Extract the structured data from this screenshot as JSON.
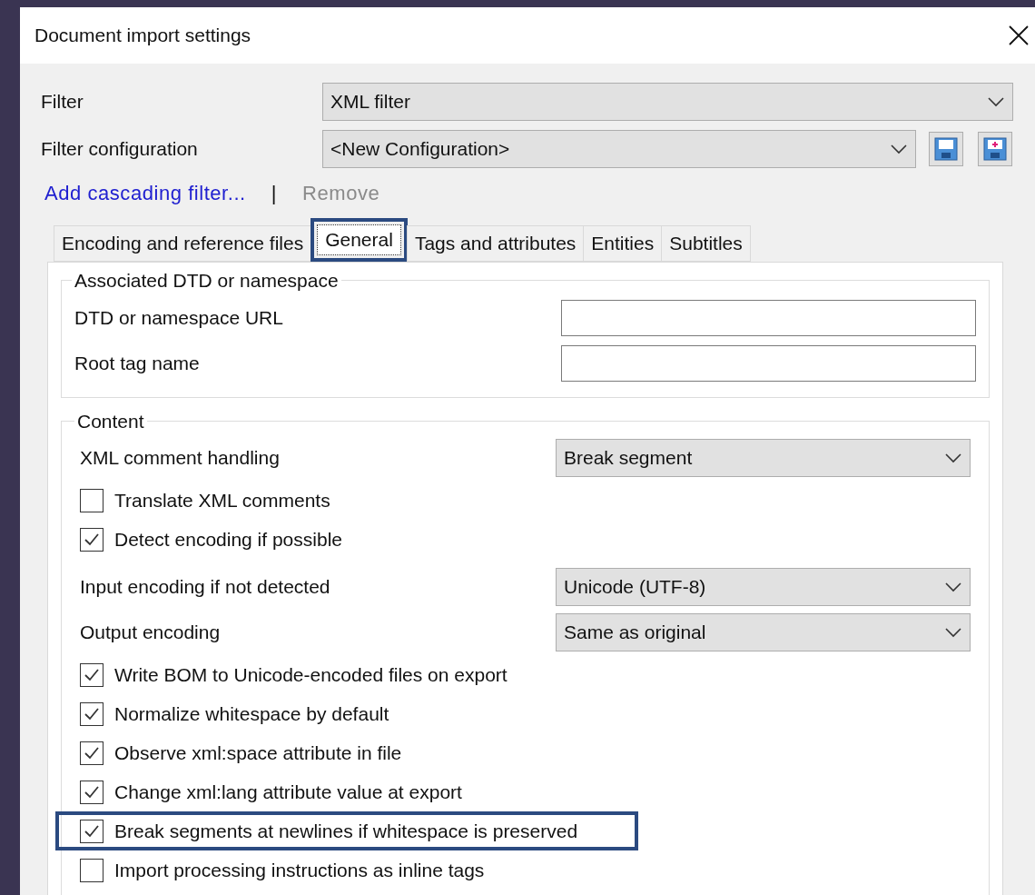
{
  "window": {
    "title": "Document import settings"
  },
  "filter": {
    "label": "Filter",
    "value": "XML filter"
  },
  "filter_configuration": {
    "label": "Filter configuration",
    "value": "<New Configuration>"
  },
  "links": {
    "add": "Add cascading filter...",
    "separator": "|",
    "remove": "Remove",
    "remove_disabled": true
  },
  "tabs": [
    {
      "label": "Encoding and reference files",
      "selected": false,
      "highlighted": false
    },
    {
      "label": "General",
      "selected": true,
      "highlighted": true
    },
    {
      "label": "Tags and attributes",
      "selected": false,
      "highlighted": false
    },
    {
      "label": "Entities",
      "selected": false,
      "highlighted": false
    },
    {
      "label": "Subtitles",
      "selected": false,
      "highlighted": false
    }
  ],
  "dtd_group": {
    "title": "Associated DTD or namespace",
    "fields": [
      {
        "label": "DTD or namespace URL"
      },
      {
        "label": "Root tag name"
      }
    ]
  },
  "content_group": {
    "title": "Content",
    "items": [
      {
        "kind": "select",
        "label": "XML comment handling",
        "value": "Break segment"
      },
      {
        "kind": "checkbox",
        "label": "Translate XML comments",
        "checked": false,
        "highlighted": false
      },
      {
        "kind": "checkbox",
        "label": "Detect encoding if possible",
        "checked": true,
        "highlighted": false
      },
      {
        "kind": "select",
        "label": "Input encoding if not detected",
        "value": "Unicode (UTF-8)"
      },
      {
        "kind": "select",
        "label": "Output encoding",
        "value": "Same as original"
      },
      {
        "kind": "checkbox",
        "label": "Write BOM to Unicode-encoded files on export",
        "checked": true,
        "highlighted": false
      },
      {
        "kind": "checkbox",
        "label": "Normalize whitespace by default",
        "checked": true,
        "highlighted": false
      },
      {
        "kind": "checkbox",
        "label": "Observe xml:space attribute in file",
        "checked": true,
        "highlighted": false
      },
      {
        "kind": "checkbox",
        "label": "Change xml:lang attribute value at export",
        "checked": true,
        "highlighted": false
      },
      {
        "kind": "checkbox",
        "label": "Break segments at newlines if whitespace is preserved",
        "checked": true,
        "highlighted": true
      },
      {
        "kind": "checkbox",
        "label": "Import processing instructions as inline tags",
        "checked": false,
        "highlighted": false
      }
    ]
  }
}
